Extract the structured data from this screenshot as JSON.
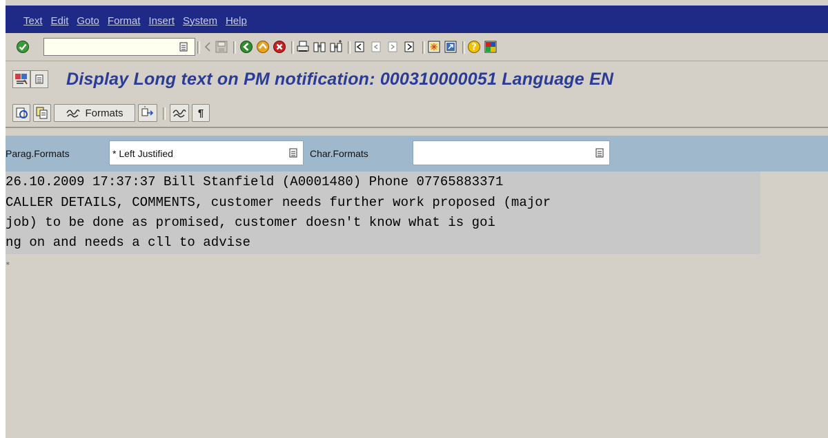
{
  "menu": {
    "items": [
      "Text",
      "Edit",
      "Goto",
      "Format",
      "Insert",
      "System",
      "Help"
    ]
  },
  "toolbar": {
    "command_field_value": "",
    "icons": [
      "enter-icon",
      "command-field-dropdown-icon",
      "back-arrow-icon",
      "save-icon",
      "back-icon",
      "exit-icon",
      "cancel-icon",
      "print-icon",
      "find-icon",
      "find-next-icon",
      "first-page-icon",
      "previous-page-icon",
      "next-page-icon",
      "last-page-icon",
      "create-session-icon",
      "create-shortcut-icon",
      "help-icon",
      "customize-layout-icon"
    ]
  },
  "title": {
    "text": "Display Long text on PM notification: 000310000051 Language EN"
  },
  "app_toolbar": {
    "formats_label": "Formats",
    "pilcrow_label": "¶"
  },
  "format_bar": {
    "parag_label": "Parag.Formats",
    "parag_value": "* Left Justified",
    "char_label": "Char.Formats",
    "char_value": ""
  },
  "editor": {
    "lines": [
      "26.10.2009 17:37:37 Bill Stanfield (A0001480) Phone 07765883371",
      "CALLER DETAILS, COMMENTS, customer needs further work proposed (major",
      "job) to be done as promised, customer doesn't know what is goi",
      "ng on and needs a cll to advise"
    ],
    "end_marker": "*"
  },
  "colors": {
    "menubar_bg": "#1e2a85",
    "title_color": "#2a3c96",
    "format_bar_bg": "#a0b8cc",
    "window_bg": "#d4d0c8",
    "text_area_bg": "#c8c8c8"
  }
}
